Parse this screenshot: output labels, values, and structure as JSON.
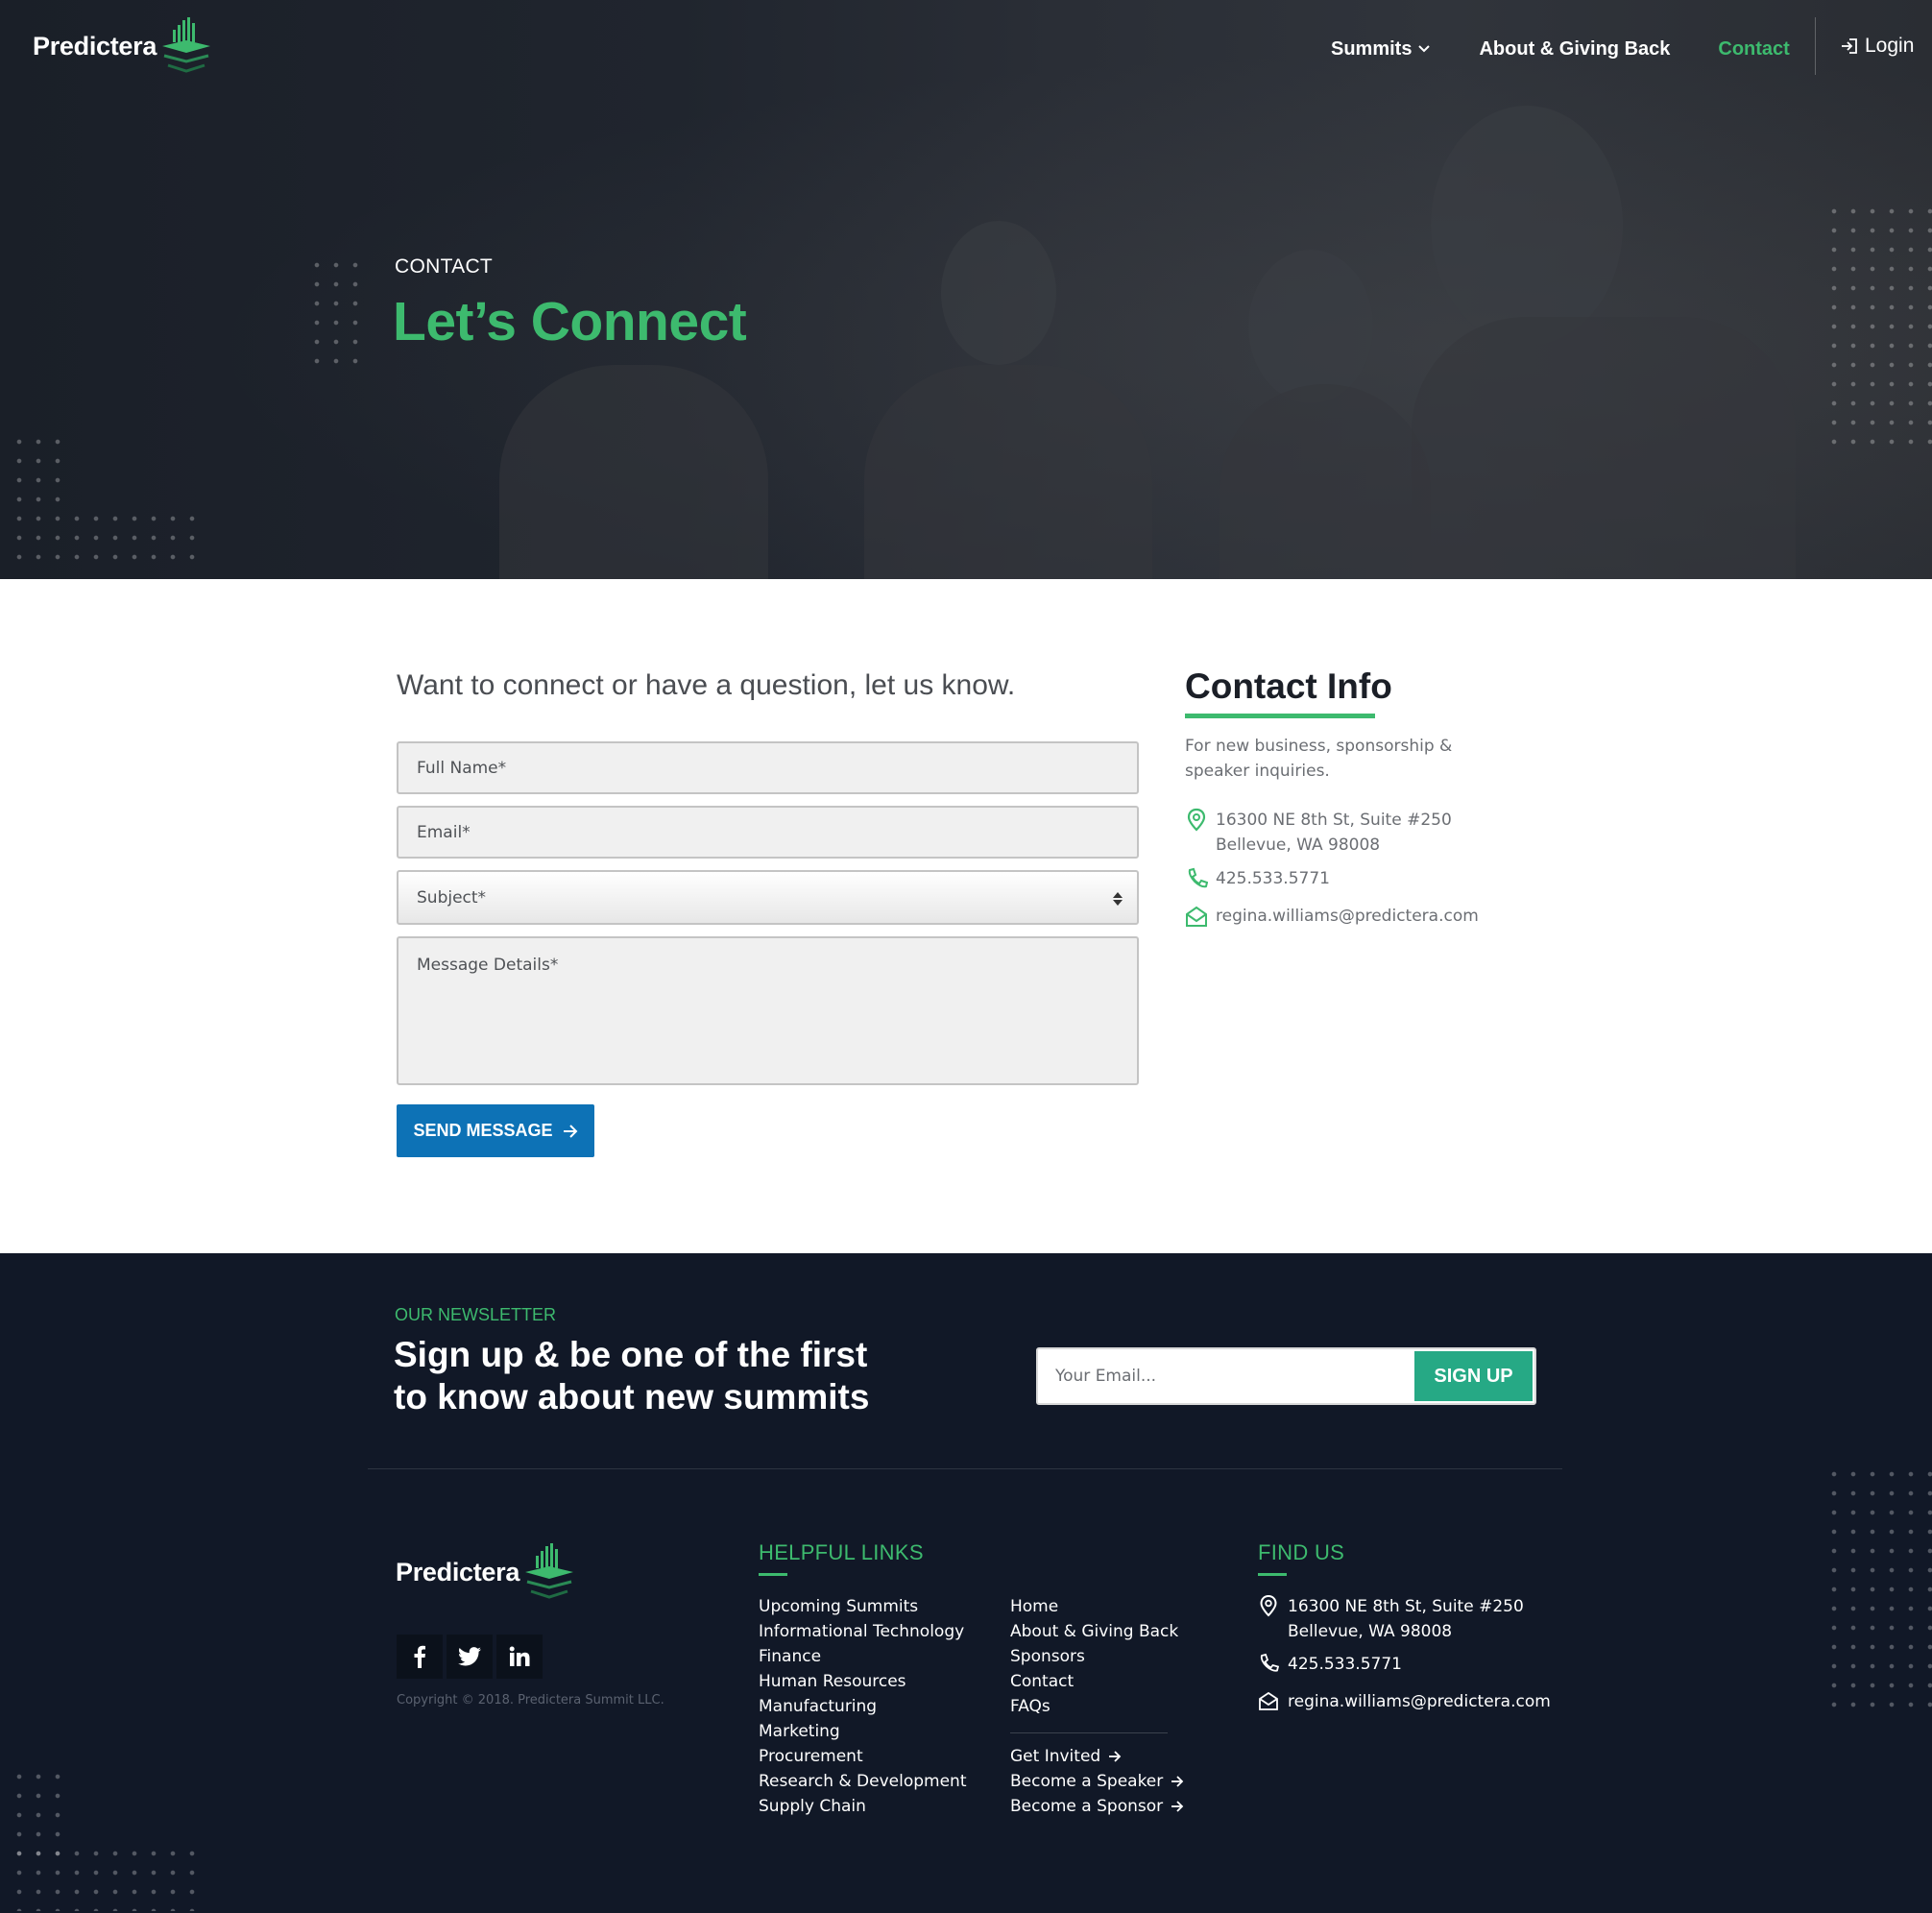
{
  "brand": {
    "name": "Predictera",
    "accent": "#3dba6e",
    "primary_button": "#0d72b6"
  },
  "nav": {
    "items": [
      {
        "label": "Summits",
        "has_dropdown": true,
        "active": false
      },
      {
        "label": "About & Giving Back",
        "active": false
      },
      {
        "label": "Contact",
        "active": true
      }
    ],
    "login": "Login"
  },
  "hero": {
    "eyebrow": "CONTACT",
    "title": "Let’s Connect"
  },
  "form": {
    "intro": "Want to connect or have a question, let us know.",
    "full_name_placeholder": "Full Name*",
    "email_placeholder": "Email*",
    "subject_selected": "Subject*",
    "message_placeholder": "Message Details*",
    "send_label": "SEND MESSAGE"
  },
  "contact_info": {
    "title": "Contact Info",
    "description": "For new business, sponsorship & speaker inquiries.",
    "address_line1": "16300 NE 8th St, Suite #250",
    "address_line2": "Bellevue, WA 98008",
    "phone": "425.533.5771",
    "email": "regina.williams@predictera.com"
  },
  "newsletter": {
    "eyebrow": "OUR NEWSLETTER",
    "title": "Sign up & be one of the first to know about new summits",
    "email_placeholder": "Your Email...",
    "signup_label": "SIGN UP"
  },
  "footer": {
    "brand": "Predictera",
    "copyright": "Copyright © 2018. Predictera Summit LLC.",
    "helpful_links_title": "HELPFUL LINKS",
    "summit_links": [
      "Upcoming Summits",
      "Informational Technology",
      "Finance",
      "Human Resources",
      "Manufacturing",
      "Marketing",
      "Procurement",
      "Research & Development",
      "Supply Chain"
    ],
    "site_links": [
      "Home",
      "About & Giving Back",
      "Sponsors",
      "Contact",
      "FAQs"
    ],
    "cta_links": [
      "Get Invited",
      "Become a Speaker",
      "Become a Sponsor"
    ],
    "find_us_title": "FIND US",
    "address_line1": "16300 NE 8th St, Suite #250",
    "address_line2": "Bellevue, WA 98008",
    "phone": "425.533.5771",
    "email": "regina.williams@predictera.com"
  },
  "icons": [
    "logo-mark-icon",
    "chevron-down-icon",
    "login-icon",
    "select-arrows-icon",
    "arrow-right-icon",
    "map-pin-icon",
    "phone-icon",
    "envelope-icon",
    "facebook-icon",
    "twitter-icon",
    "linkedin-icon"
  ]
}
